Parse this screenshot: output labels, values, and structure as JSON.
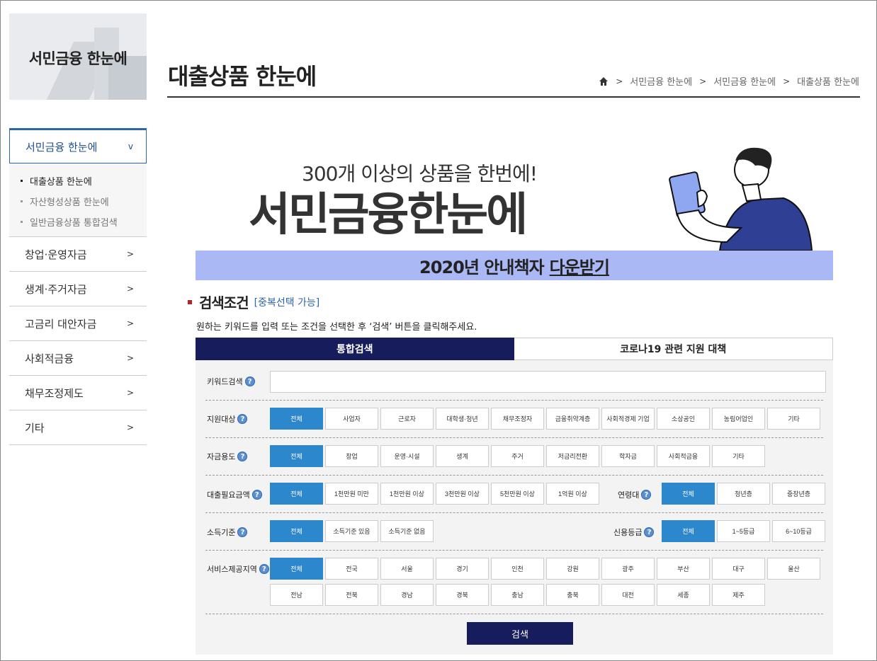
{
  "sidebar": {
    "logo_title": "서민금융 한눈에",
    "active": {
      "label": "서민금융 한눈에",
      "chevron": "v"
    },
    "sub_items": [
      {
        "label": "대출상품 한눈에"
      },
      {
        "label": "자산형성상품 한눈에"
      },
      {
        "label": "일반금융상품 통합검색"
      }
    ],
    "items": [
      {
        "label": "창업·운영자금",
        "arrow": ">"
      },
      {
        "label": "생계·주거자금",
        "arrow": ">"
      },
      {
        "label": "고금리 대안자금",
        "arrow": ">"
      },
      {
        "label": "사회적금융",
        "arrow": ">"
      },
      {
        "label": "채무조정제도",
        "arrow": ">"
      },
      {
        "label": "기타",
        "arrow": ">"
      }
    ]
  },
  "header": {
    "title": "대출상품 한눈에",
    "breadcrumb": [
      "서민금융 한눈에",
      "서민금융 한눈에",
      "대출상품 한눈에"
    ],
    "home_icon": "home-icon"
  },
  "banner": {
    "subtitle": "300개 이상의 상품을 한번에!",
    "title": "서민금융한눈에",
    "strip_text": "2020년 안내책자",
    "strip_link": "다운받기",
    "strip_color": "#aab9f5"
  },
  "search": {
    "title": "검색조건",
    "multi": "[중복선택 가능]",
    "desc": "원하는 키워드를 입력 또는 조건을 선택한 후 ‘검색’ 버튼을 클릭해주세요.",
    "tabs": [
      "통합검색",
      "코로나19 관련 지원 대책"
    ],
    "keyword_label": "키워드검색",
    "target_label": "지원대상",
    "target_options": [
      "전체",
      "사업자",
      "근로자",
      "대학생·청년",
      "채무조정자",
      "금융취약계층",
      "사회적경제 기업",
      "소상공인",
      "농림어업인",
      "기타"
    ],
    "purpose_label": "자금용도",
    "purpose_options": [
      "전체",
      "창업",
      "운영·시설",
      "생계",
      "주거",
      "저금리전환",
      "학자금",
      "사회적금융",
      "기타"
    ],
    "amount_label": "대출필요금액",
    "amount_options": [
      "전체",
      "1천만원 미만",
      "1천만원 이상",
      "3천만원 이상",
      "5천만원 이상",
      "1억원 이상"
    ],
    "age_label": "연령대",
    "age_options": [
      "전체",
      "청년층",
      "중장년층"
    ],
    "income_label": "소득기준",
    "income_options": [
      "전체",
      "소득기준 있음",
      "소득기준 없음"
    ],
    "credit_label": "신용등급",
    "credit_options": [
      "전체",
      "1~5등급",
      "6~10등급"
    ],
    "region_label": "서비스제공지역",
    "region_options": [
      "전체",
      "전국",
      "서울",
      "경기",
      "인천",
      "강원",
      "광주",
      "부산",
      "대구",
      "울산",
      "전남",
      "전북",
      "경남",
      "경북",
      "충남",
      "충북",
      "대전",
      "세종",
      "제주"
    ],
    "search_button": "검색",
    "accent_color": "#2d87cc",
    "navy_color": "#161c5c"
  }
}
